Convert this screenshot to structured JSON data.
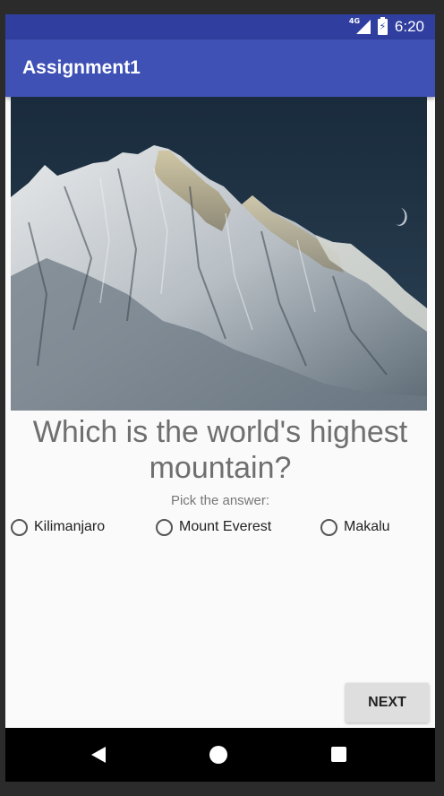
{
  "status_bar": {
    "network_label": "4G",
    "time": "6:20"
  },
  "app_bar": {
    "title": "Assignment1"
  },
  "quiz": {
    "image_icon": "mountain-image",
    "question": "Which is the world's highest mountain?",
    "hint": "Pick the answer:",
    "options": [
      {
        "label": "Kilimanjaro",
        "selected": false
      },
      {
        "label": "Mount Everest",
        "selected": false
      },
      {
        "label": "Makalu",
        "selected": false
      }
    ],
    "next_label": "NEXT"
  },
  "nav_bar": {
    "back_icon": "back-icon",
    "home_icon": "home-icon",
    "recents_icon": "recents-icon"
  },
  "colors": {
    "status_bar": "#303f9f",
    "app_bar": "#3f51b5",
    "background": "#fafafa",
    "button": "#dedede"
  }
}
